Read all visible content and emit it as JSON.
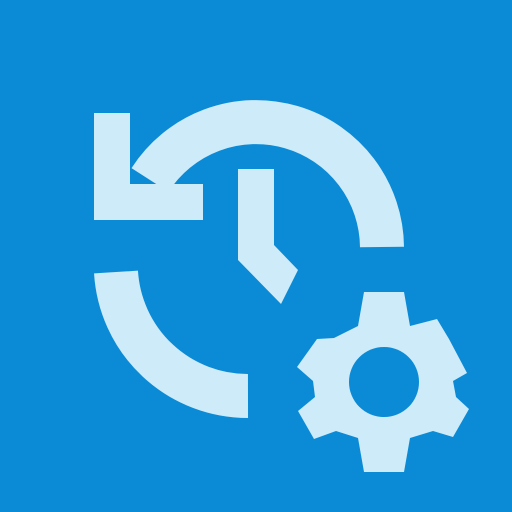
{
  "icon": {
    "name": "history-settings-icon",
    "colors": {
      "background": "#0b8ad6",
      "foreground": "#cdebf8"
    }
  }
}
